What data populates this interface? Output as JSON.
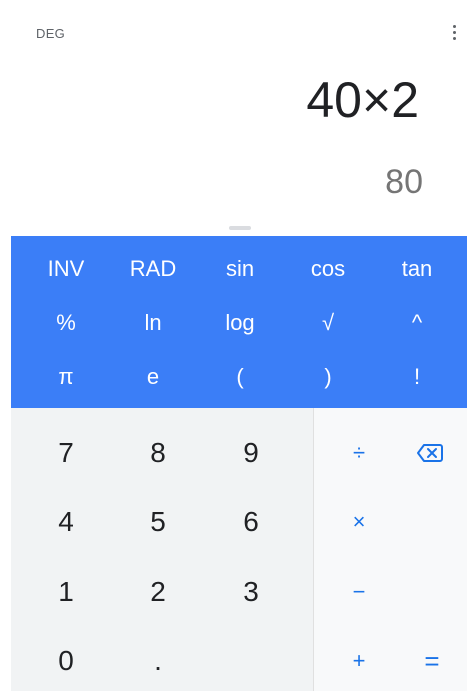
{
  "display": {
    "angle_mode": "DEG",
    "expression": "40×2",
    "result": "80"
  },
  "scientific_keys": {
    "row1": [
      "INV",
      "RAD",
      "sin",
      "cos",
      "tan"
    ],
    "row2": [
      "%",
      "ln",
      "log",
      "√",
      "^"
    ],
    "row3": [
      "π",
      "e",
      "(",
      ")",
      "!"
    ]
  },
  "number_keys": {
    "row1": [
      "7",
      "8",
      "9"
    ],
    "row2": [
      "4",
      "5",
      "6"
    ],
    "row3": [
      "1",
      "2",
      "3"
    ],
    "row4": [
      "0",
      "."
    ]
  },
  "operator_keys": {
    "divide": "÷",
    "multiply": "×",
    "minus": "−",
    "plus": "+",
    "equals": "="
  },
  "icons": {
    "backspace": "backspace-icon",
    "menu": "more-vert-icon"
  },
  "colors": {
    "accent": "#1a73e8",
    "scientific_panel": "#3b7ef7",
    "number_pad": "#f1f3f4"
  }
}
